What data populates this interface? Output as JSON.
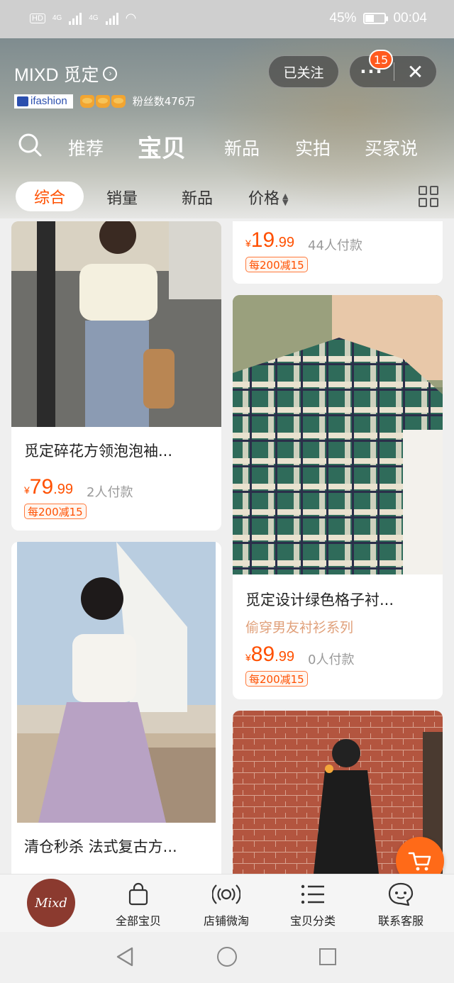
{
  "status_bar": {
    "net_left": "HD",
    "net1": "4G",
    "net2": "4G",
    "battery": "45%",
    "battery_level": 0.45,
    "time": "00:04"
  },
  "shop": {
    "name": "MIXD 觅定",
    "badge": "ifashion",
    "fans": "粉丝数476万",
    "follow_label": "已关注",
    "more_label": "···",
    "close_label": "✕",
    "message_count": "15"
  },
  "tabs": [
    {
      "label": "推荐"
    },
    {
      "label": "宝贝"
    },
    {
      "label": "新品"
    },
    {
      "label": "实拍"
    },
    {
      "label": "买家说"
    }
  ],
  "filter": {
    "items": [
      {
        "label": "综合"
      },
      {
        "label": "销量"
      },
      {
        "label": "新品"
      },
      {
        "label": "价格"
      }
    ]
  },
  "products": [
    {
      "title": "觅定碎花方领泡泡袖...",
      "currency": "¥",
      "price_int": "79",
      "price_dec": ".99",
      "sold": "2人付款",
      "promo": "每200减15"
    },
    {
      "currency": "¥",
      "price_int": "19",
      "price_dec": ".99",
      "sold": "44人付款",
      "promo": "每200减15"
    },
    {
      "title": "觅定设计绿色格子衬...",
      "subtitle": "偷穿男友衬衫系列",
      "currency": "¥",
      "price_int": "89",
      "price_dec": ".99",
      "sold": "0人付款",
      "promo": "每200减15"
    },
    {
      "title": "清仓秒杀 法式复古方..."
    },
    {}
  ],
  "bottom_nav": {
    "logo_text": "Mixd",
    "items": [
      {
        "label": "全部宝贝",
        "icon": "shopping-bag-icon"
      },
      {
        "label": "店铺微淘",
        "icon": "broadcast-icon"
      },
      {
        "label": "宝贝分类",
        "icon": "list-icon"
      },
      {
        "label": "联系客服",
        "icon": "chat-icon"
      }
    ]
  },
  "colors": {
    "accent": "#ff5000",
    "logo_bg": "#8b3a2f"
  }
}
